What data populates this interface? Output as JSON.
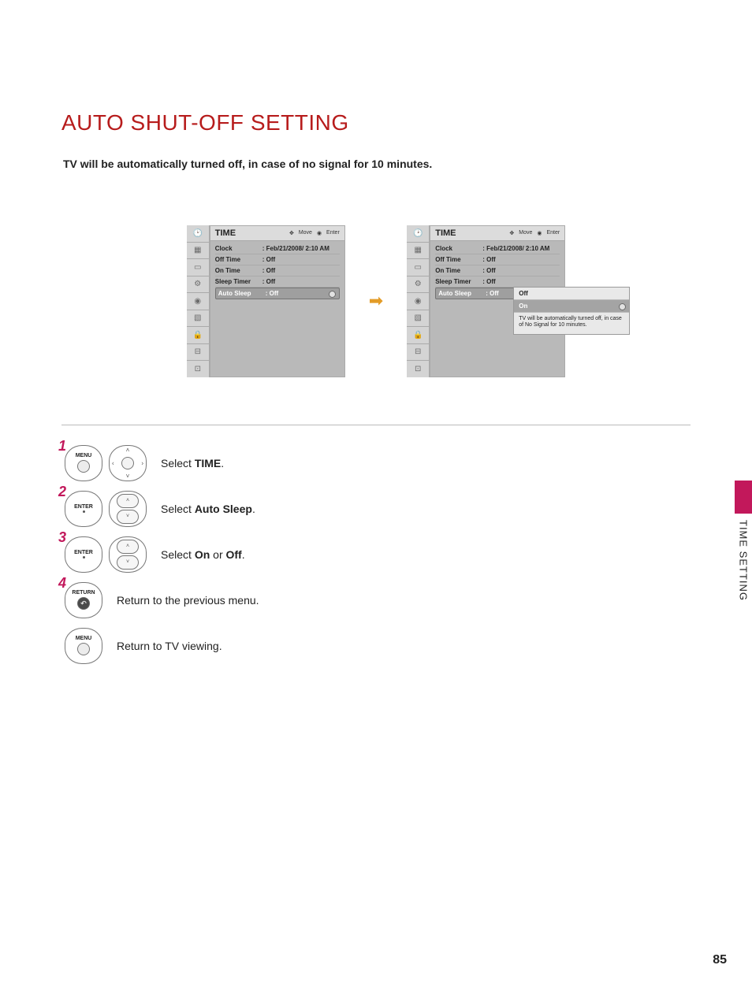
{
  "title": "AUTO SHUT-OFF SETTING",
  "subtitle": "TV will be automatically turned off, in case of no signal for 10 minutes.",
  "section_vertical": "TIME SETTING",
  "page_number": "85",
  "osd": {
    "panel_title": "TIME",
    "helper_move": "Move",
    "helper_enter": "Enter",
    "rows": {
      "clock": {
        "label": "Clock",
        "value": ": Feb/21/2008/ 2:10 AM"
      },
      "offtime": {
        "label": "Off Time",
        "value": ": Off"
      },
      "ontime": {
        "label": "On Time",
        "value": ": Off"
      },
      "sleep": {
        "label": "Sleep Timer",
        "value": ": Off"
      },
      "autosleep": {
        "label": "Auto Sleep",
        "value": ": Off"
      }
    }
  },
  "popup": {
    "off": "Off",
    "on": "On",
    "note": "TV will be automatically turned off, in case of No Signal for 10 minutes."
  },
  "steps": {
    "s1": {
      "num": "1",
      "btn": "MENU",
      "text_a": "Select ",
      "text_b": "TIME",
      "text_c": "."
    },
    "s2": {
      "num": "2",
      "btn": "ENTER",
      "text_a": "Select ",
      "text_b": "Auto Sleep",
      "text_c": "."
    },
    "s3": {
      "num": "3",
      "btn": "ENTER",
      "text_a": "Select ",
      "text_b": "On",
      "text_mid": " or ",
      "text_b2": "Off",
      "text_c": "."
    },
    "s4": {
      "num": "4",
      "btn": "RETURN",
      "text": "Return to the previous menu."
    },
    "s5": {
      "btn": "MENU",
      "text": "Return to TV viewing."
    }
  },
  "icons": {
    "sidebar": [
      "time-icon",
      "picture-icon",
      "audio-small-icon",
      "settings-icon",
      "audio-icon",
      "clock-icon",
      "lock-icon",
      "input-icon",
      "usb-icon"
    ]
  }
}
